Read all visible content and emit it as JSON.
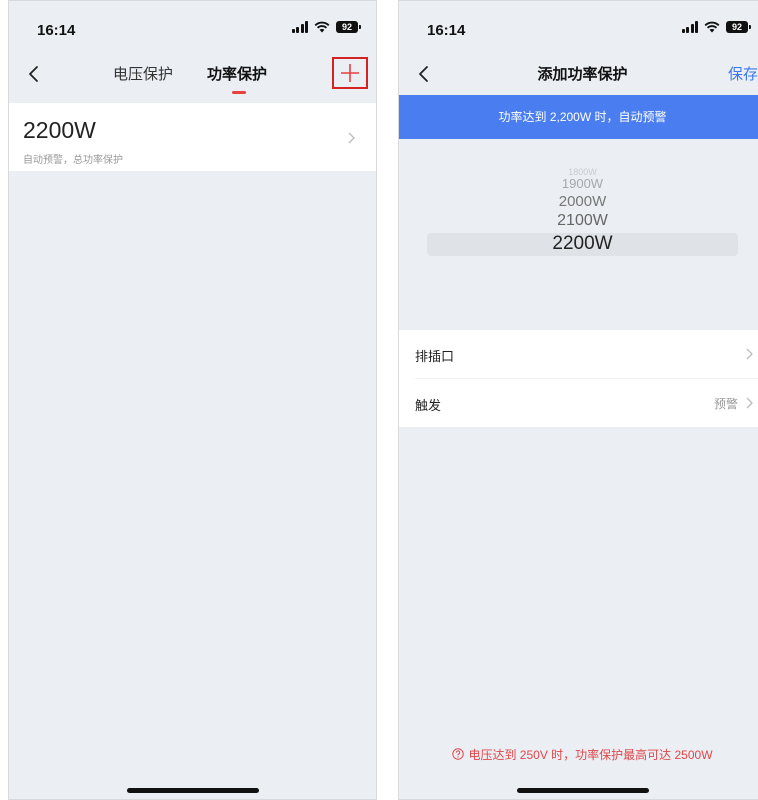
{
  "left": {
    "status_time": "16:14",
    "battery": "92",
    "tabs": [
      {
        "label": "电压保护"
      },
      {
        "label": "功率保护"
      }
    ],
    "add_symbol": "+",
    "item": {
      "title": "2200W",
      "subtitle": "自动预警，总功率保护"
    }
  },
  "right": {
    "status_time": "16:14",
    "battery": "92",
    "title": "添加功率保护",
    "save_label": "保存",
    "banner": "功率达到 2,200W 时，自动预警",
    "picker": {
      "options": [
        "1800W",
        "1900W",
        "2000W",
        "2100W",
        "2200W"
      ],
      "selected": "2200W"
    },
    "rows": [
      {
        "label": "排插口",
        "value": ""
      },
      {
        "label": "触发",
        "value": "预警"
      }
    ],
    "footer_note": "电压达到 250V 时，功率保护最高可达 2500W"
  },
  "colors": {
    "accent_red": "#e8413f",
    "accent_blue": "#3a78f2",
    "banner_blue": "#4a7ef0",
    "highlight_border": "#d32222"
  }
}
